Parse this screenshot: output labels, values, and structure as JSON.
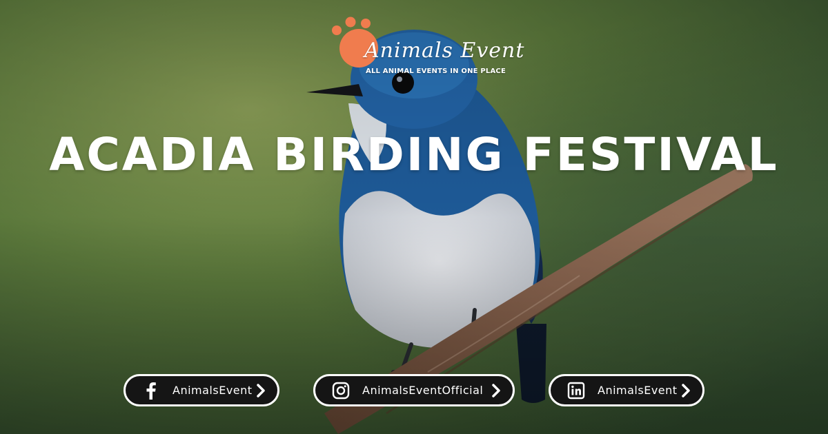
{
  "brand": {
    "name": "Animals Event",
    "tagline": "ALL ANIMAL EVENTS IN ONE PLACE",
    "accent_color": "#F07C4E"
  },
  "event": {
    "title": "ACADIA BIRDING FESTIVAL"
  },
  "social": [
    {
      "icon": "facebook-icon",
      "handle": "AnimalsEvent"
    },
    {
      "icon": "instagram-icon",
      "handle": "AnimalsEventOfficial"
    },
    {
      "icon": "linkedin-icon",
      "handle": "AnimalsEvent"
    }
  ],
  "colors": {
    "background_green": "#6E8A43",
    "bird_blue": "#1F5E9E",
    "pill_background": "#151515"
  }
}
